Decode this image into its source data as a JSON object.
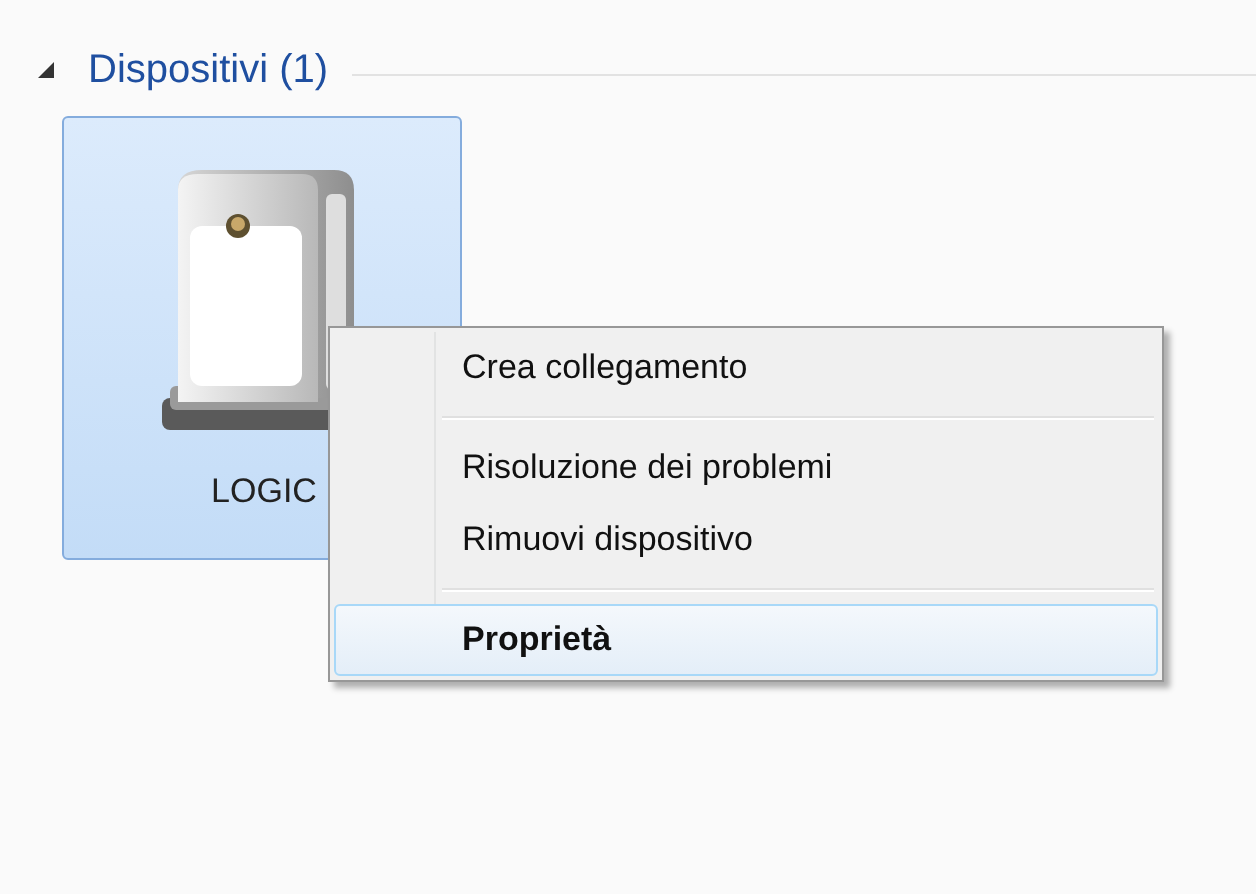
{
  "group": {
    "title": "Dispositivi (1)",
    "expanded": true
  },
  "devices": [
    {
      "label": "LOGIC",
      "selected": true
    }
  ],
  "context_menu": {
    "items": [
      {
        "kind": "item",
        "label": "Crea collegamento",
        "default": false,
        "selected": false
      },
      {
        "kind": "separator"
      },
      {
        "kind": "item",
        "label": "Risoluzione dei problemi",
        "default": false,
        "selected": false
      },
      {
        "kind": "item",
        "label": "Rimuovi dispositivo",
        "default": false,
        "selected": false
      },
      {
        "kind": "separator"
      },
      {
        "kind": "item",
        "label": "Proprietà",
        "default": true,
        "selected": true
      }
    ]
  }
}
